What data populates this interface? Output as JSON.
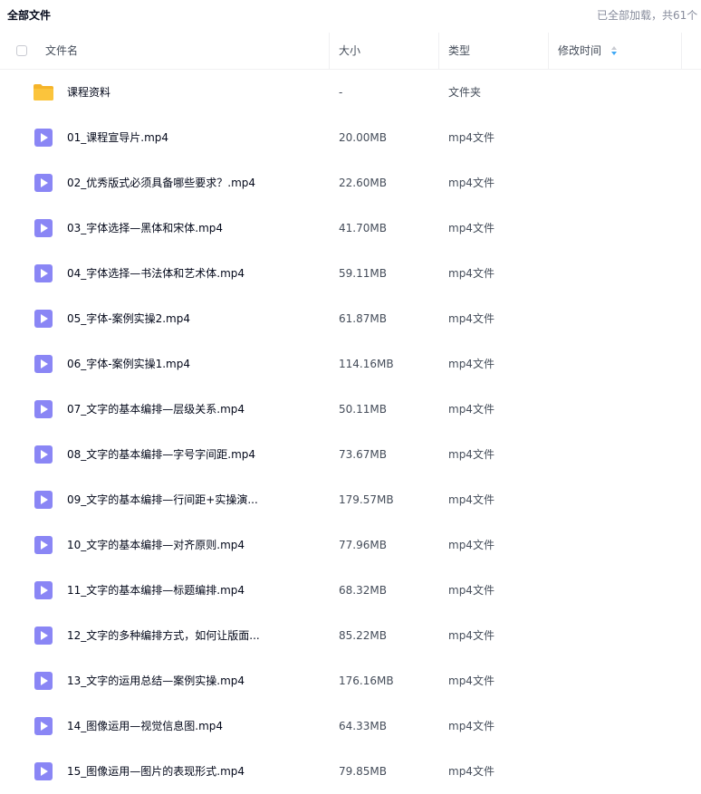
{
  "header": {
    "breadcrumb": "全部文件",
    "loaded_status": "已全部加载，共61个"
  },
  "columns": {
    "name": "文件名",
    "size": "大小",
    "type": "类型",
    "modified": "修改时间"
  },
  "colors": {
    "video_icon": "#8a86f5",
    "folder_icon": "#fbc43c",
    "sort_up": "#c8cad1",
    "sort_down": "#3ea8f5"
  },
  "files": [
    {
      "name": "课程资料",
      "size": "-",
      "type": "文件夹",
      "icon": "folder-icon"
    },
    {
      "name": "01_课程宣导片.mp4",
      "size": "20.00MB",
      "type": "mp4文件",
      "icon": "video-file-icon"
    },
    {
      "name": "02_优秀版式必须具备哪些要求？.mp4",
      "size": "22.60MB",
      "type": "mp4文件",
      "icon": "video-file-icon"
    },
    {
      "name": "03_字体选择—黑体和宋体.mp4",
      "size": "41.70MB",
      "type": "mp4文件",
      "icon": "video-file-icon"
    },
    {
      "name": "04_字体选择—书法体和艺术体.mp4",
      "size": "59.11MB",
      "type": "mp4文件",
      "icon": "video-file-icon"
    },
    {
      "name": "05_字体-案例实操2.mp4",
      "size": "61.87MB",
      "type": "mp4文件",
      "icon": "video-file-icon"
    },
    {
      "name": "06_字体-案例实操1.mp4",
      "size": "114.16MB",
      "type": "mp4文件",
      "icon": "video-file-icon"
    },
    {
      "name": "07_文字的基本编排—层级关系.mp4",
      "size": "50.11MB",
      "type": "mp4文件",
      "icon": "video-file-icon"
    },
    {
      "name": "08_文字的基本编排—字号字间距.mp4",
      "size": "73.67MB",
      "type": "mp4文件",
      "icon": "video-file-icon"
    },
    {
      "name": "09_文字的基本编排—行间距+实操演...",
      "size": "179.57MB",
      "type": "mp4文件",
      "icon": "video-file-icon"
    },
    {
      "name": "10_文字的基本编排—对齐原则.mp4",
      "size": "77.96MB",
      "type": "mp4文件",
      "icon": "video-file-icon"
    },
    {
      "name": "11_文字的基本编排—标题编排.mp4",
      "size": "68.32MB",
      "type": "mp4文件",
      "icon": "video-file-icon"
    },
    {
      "name": "12_文字的多种编排方式，如何让版面...",
      "size": "85.22MB",
      "type": "mp4文件",
      "icon": "video-file-icon"
    },
    {
      "name": "13_文字的运用总结—案例实操.mp4",
      "size": "176.16MB",
      "type": "mp4文件",
      "icon": "video-file-icon"
    },
    {
      "name": "14_图像运用—视觉信息图.mp4",
      "size": "64.33MB",
      "type": "mp4文件",
      "icon": "video-file-icon"
    },
    {
      "name": "15_图像运用—图片的表现形式.mp4",
      "size": "79.85MB",
      "type": "mp4文件",
      "icon": "video-file-icon"
    }
  ]
}
